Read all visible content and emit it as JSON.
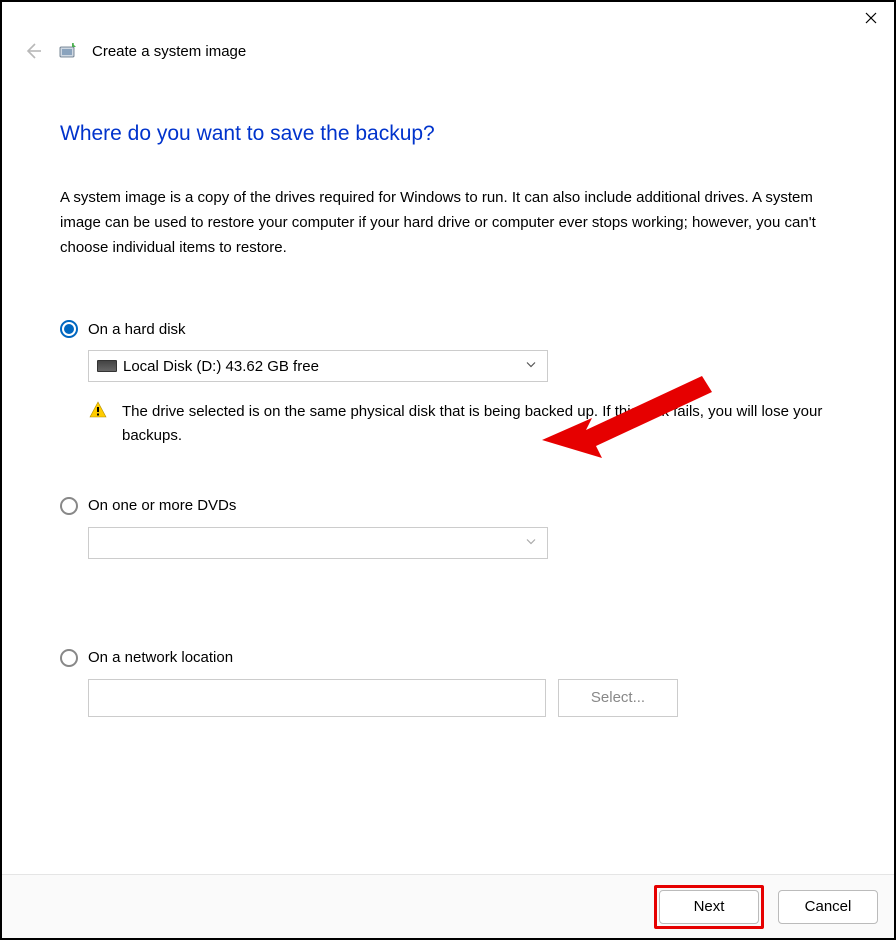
{
  "titlebar": {
    "close_symbol": "✕"
  },
  "header": {
    "title": "Create a system image"
  },
  "page": {
    "heading": "Where do you want to save the backup?",
    "description": "A system image is a copy of the drives required for Windows to run. It can also include additional drives. A system image can be used to restore your computer if your hard drive or computer ever stops working; however, you can't choose individual items to restore."
  },
  "options": {
    "hard_disk": {
      "label": "On a hard disk",
      "selected_drive": "Local Disk (D:)  43.62 GB free",
      "warning": "The drive selected is on the same physical disk that is being backed up. If this disk fails, you will lose your backups."
    },
    "dvds": {
      "label": "On one or more DVDs"
    },
    "network": {
      "label": "On a network location",
      "path": "",
      "select_button": "Select..."
    }
  },
  "footer": {
    "next": "Next",
    "cancel": "Cancel"
  }
}
